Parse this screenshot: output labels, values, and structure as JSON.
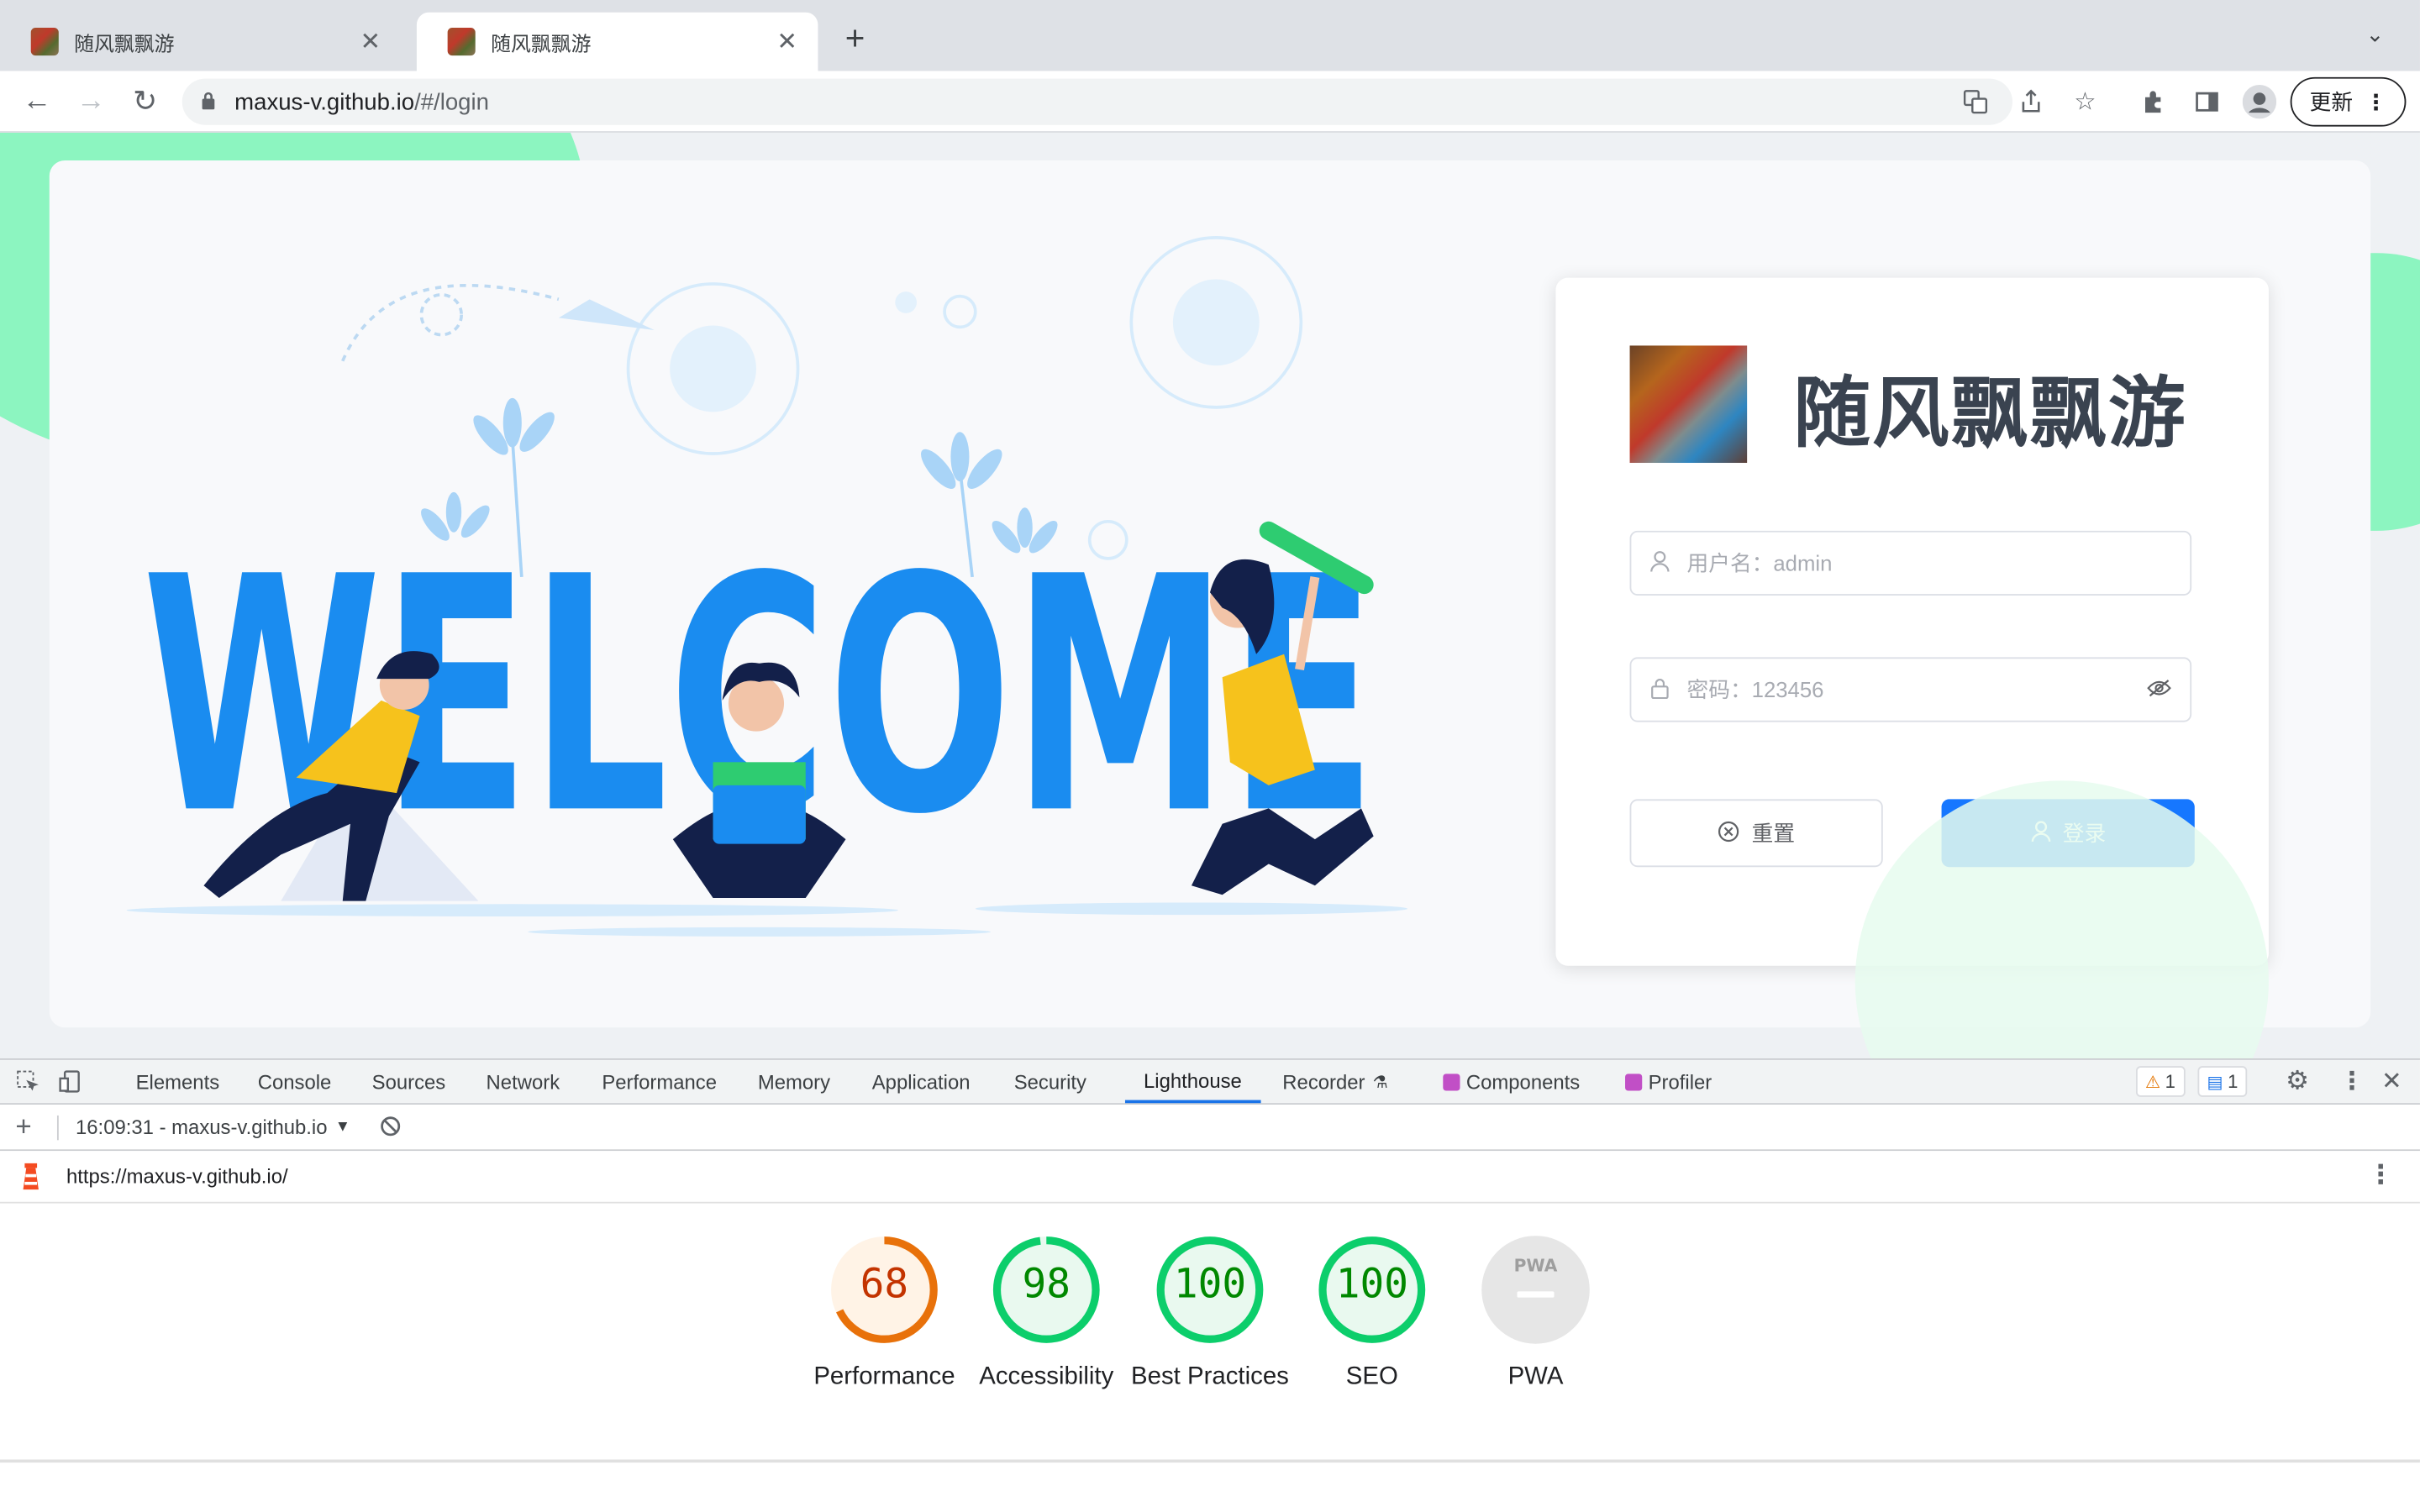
{
  "browser": {
    "tabs": [
      {
        "title": "随风飘飘游",
        "close": "✕"
      },
      {
        "title": "随风飘飘游",
        "close": "✕"
      }
    ],
    "new_tab": "+",
    "tab_menu": "⌄",
    "url_host": "maxus-v.github.io",
    "url_rest": "/#/login",
    "update_label": "更新"
  },
  "login": {
    "brand": "随风飘飘游",
    "username_placeholder": "用户名：admin",
    "password_placeholder": "密码：123456",
    "reset_label": "重置",
    "login_label": "登录"
  },
  "devtools": {
    "tabs": [
      "Elements",
      "Console",
      "Sources",
      "Network",
      "Performance",
      "Memory",
      "Application",
      "Security",
      "Lighthouse",
      "Recorder",
      "Components",
      "Profiler"
    ],
    "warnings_count": "1",
    "messages_count": "1",
    "report_selector": "16:09:31 - maxus-v.github.io",
    "report_url": "https://maxus-v.github.io/",
    "scores": [
      {
        "value": "68",
        "label": "Performance",
        "score": 68,
        "color": "#e8710a",
        "fill": "#fff3e6"
      },
      {
        "value": "98",
        "label": "Accessibility",
        "score": 98,
        "color": "#0cce6b",
        "fill": "#e9f9ef"
      },
      {
        "value": "100",
        "label": "Best Practices",
        "score": 100,
        "color": "#0cce6b",
        "fill": "#e9f9ef"
      },
      {
        "value": "100",
        "label": "SEO",
        "score": 100,
        "color": "#0cce6b",
        "fill": "#e9f9ef"
      },
      {
        "value": "",
        "label": "PWA",
        "score": 0,
        "color": "#e0e0e0",
        "fill": "#e6e6e6"
      }
    ],
    "pwa_badge": "PWA"
  },
  "welcome_text": "WELCOME"
}
